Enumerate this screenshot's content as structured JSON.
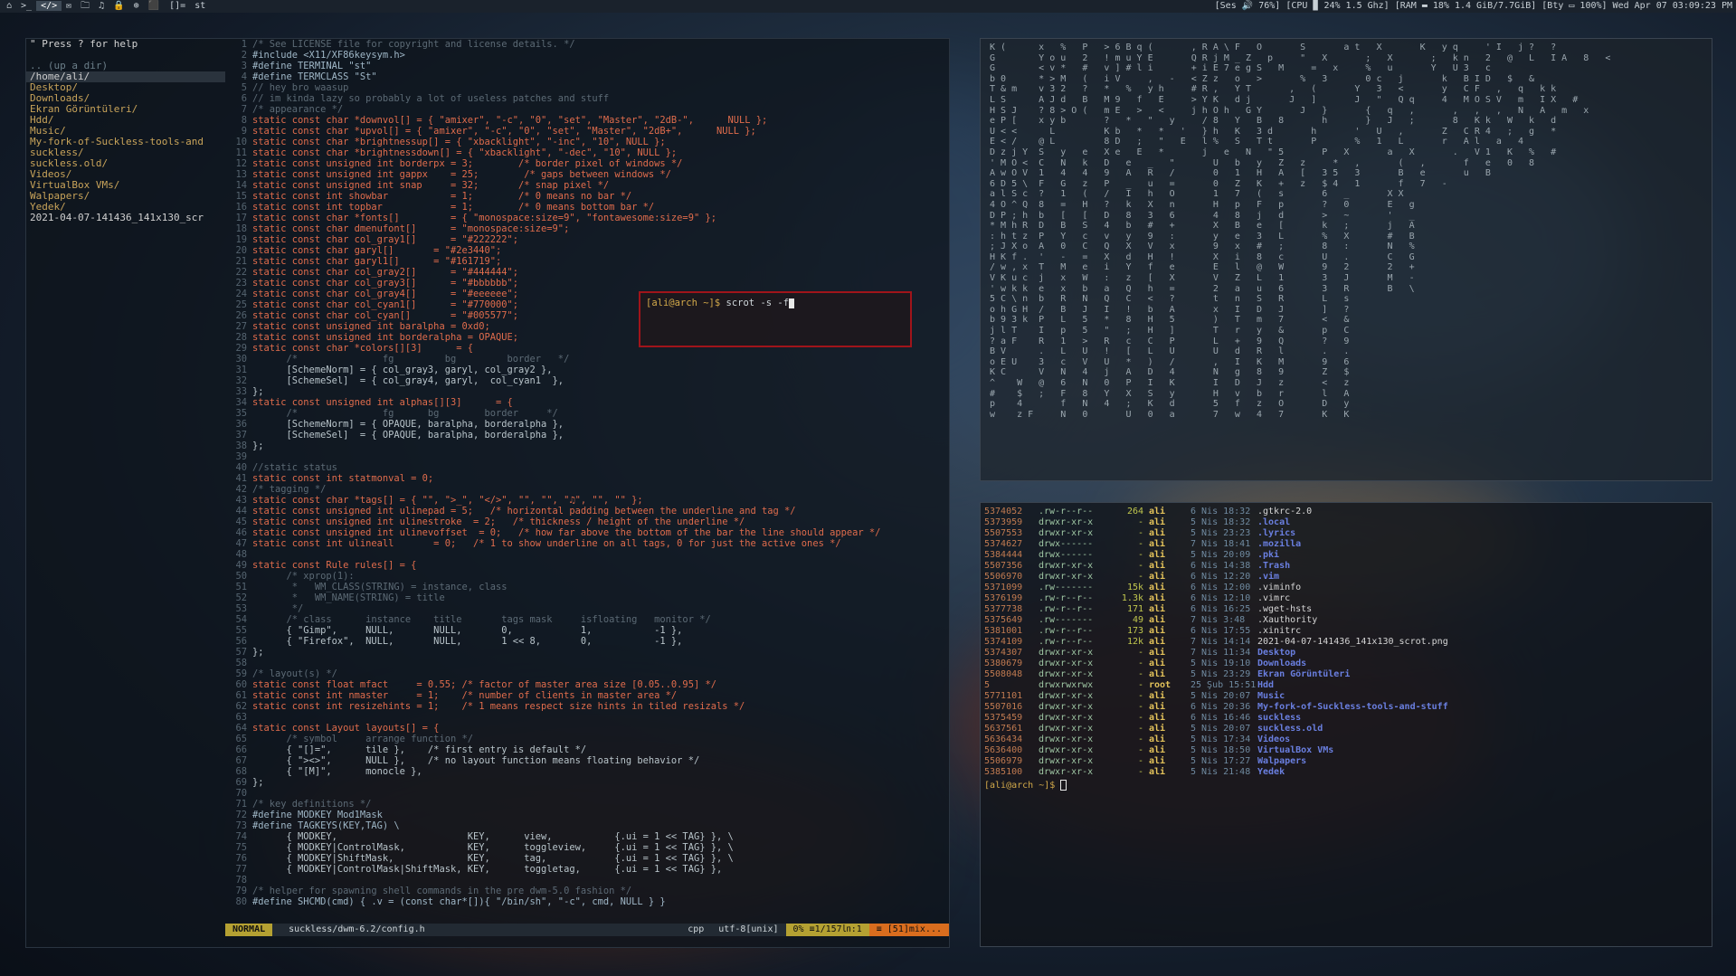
{
  "bar": {
    "tags": [
      "⌂",
      ">_",
      "</>",
      "✉",
      "🗀",
      "♫",
      "🔒",
      "⊕",
      "⬛"
    ],
    "active_tag_index": 2,
    "layout": "[]=",
    "window_title": "st",
    "status": "[Ses 🔊 76%] [CPU ▉ 24% 1.5 Ghz] [RAM ▬ 18% 1.4 GiB/7.7GiB] [Bty ▭ 100%] Wed Apr 07 03:09:23 PM"
  },
  "file_pane": {
    "help": "\" Press ? for help",
    "up": ".. (up a dir)",
    "cwd": "/home/ali/",
    "entries": [
      {
        "name": "Desktop/",
        "dir": true
      },
      {
        "name": "Downloads/",
        "dir": true
      },
      {
        "name": "Ekran Görüntüleri/",
        "dir": true
      },
      {
        "name": "Hdd/",
        "dir": true
      },
      {
        "name": "Music/",
        "dir": true
      },
      {
        "name": "My-fork-of-Suckless-tools-and",
        "dir": true
      },
      {
        "name": "suckless/",
        "dir": true
      },
      {
        "name": "suckless.old/",
        "dir": true
      },
      {
        "name": "Videos/",
        "dir": true
      },
      {
        "name": "VirtualBox VMs/",
        "dir": true
      },
      {
        "name": "Walpapers/",
        "dir": true
      },
      {
        "name": "Yedek/",
        "dir": true
      },
      {
        "name": "2021-04-07-141436_141x130_scr",
        "dir": false
      }
    ]
  },
  "code_lines": [
    {
      "t": "/* See LICENSE file for copyright and license details. */",
      "c": "cmt"
    },
    {
      "t": "#include <X11/XF86keysym.h>",
      "c": "pre"
    },
    {
      "t": "#define TERMINAL \"st\"",
      "c": "pre"
    },
    {
      "t": "#define TERMCLASS \"St\"",
      "c": "pre"
    },
    {
      "t": "// hey bro waasup",
      "c": "cmt"
    },
    {
      "t": "// im kinda lazy so probably a lot of useless patches and stuff",
      "c": "cmt"
    },
    {
      "t": "/* appearance */",
      "c": "cmt"
    },
    {
      "t": "static const char *downvol[] = { \"amixer\", \"-c\", \"0\", \"set\", \"Master\", \"2dB-\",      NULL };",
      "c": "k1"
    },
    {
      "t": "static const char *upvol[] = { \"amixer\", \"-c\", \"0\", \"set\", \"Master\", \"2dB+\",      NULL };",
      "c": "k1"
    },
    {
      "t": "static const char *brightnessup[] = { \"xbacklight\", \"-inc\", \"10\", NULL };",
      "c": "k1"
    },
    {
      "t": "static const char *brightnessdown[] = { \"xbacklight\", \"-dec\", \"10\", NULL };",
      "c": "k1"
    },
    {
      "t": "static const unsigned int borderpx = 3;        /* border pixel of windows */",
      "c": "k1"
    },
    {
      "t": "static const unsigned int gappx    = 25;        /* gaps between windows */",
      "c": "k1"
    },
    {
      "t": "static const unsigned int snap     = 32;       /* snap pixel */",
      "c": "k1"
    },
    {
      "t": "static const int showbar           = 1;        /* 0 means no bar */",
      "c": "k1"
    },
    {
      "t": "static const int topbar            = 1;        /* 0 means bottom bar */",
      "c": "k1"
    },
    {
      "t": "static const char *fonts[]         = { \"monospace:size=9\", \"fontawesome:size=9\" };",
      "c": "k1"
    },
    {
      "t": "static const char dmenufont[]      = \"monospace:size=9\";",
      "c": "k1"
    },
    {
      "t": "static const char col_gray1[]      = \"#222222\";",
      "c": "k1"
    },
    {
      "t": "static const char garyl[]       = \"#2e3440\";",
      "c": "k1"
    },
    {
      "t": "static const char garyl1[]      = \"#161719\";",
      "c": "k1"
    },
    {
      "t": "static const char col_gray2[]      = \"#444444\";",
      "c": "k1"
    },
    {
      "t": "static const char col_gray3[]      = \"#bbbbbb\";",
      "c": "k1"
    },
    {
      "t": "static const char col_gray4[]      = \"#eeeeee\";",
      "c": "k1"
    },
    {
      "t": "static const char col_cyan1[]      = \"#770000\";",
      "c": "k1"
    },
    {
      "t": "static const char col_cyan[]       = \"#005577\";",
      "c": "k1"
    },
    {
      "t": "static const unsigned int baralpha = 0xd0;",
      "c": "k1"
    },
    {
      "t": "static const unsigned int borderalpha = OPAQUE;",
      "c": "k1"
    },
    {
      "t": "static const char *colors[][3]      = {",
      "c": "k1"
    },
    {
      "t": "      /*               fg         bg         border   */",
      "c": "cmt"
    },
    {
      "t": "      [SchemeNorm] = { col_gray3, garyl, col_gray2 },",
      "c": ""
    },
    {
      "t": "      [SchemeSel]  = { col_gray4, garyl,  col_cyan1  },",
      "c": ""
    },
    {
      "t": "};",
      "c": ""
    },
    {
      "t": "static const unsigned int alphas[][3]      = {",
      "c": "k1"
    },
    {
      "t": "      /*               fg      bg        border     */",
      "c": "cmt"
    },
    {
      "t": "      [SchemeNorm] = { OPAQUE, baralpha, borderalpha },",
      "c": ""
    },
    {
      "t": "      [SchemeSel]  = { OPAQUE, baralpha, borderalpha },",
      "c": ""
    },
    {
      "t": "};",
      "c": ""
    },
    {
      "t": "",
      "c": ""
    },
    {
      "t": "//static status",
      "c": "cmt"
    },
    {
      "t": "static const int statmonval = 0;",
      "c": "k1"
    },
    {
      "t": "/* tagging */",
      "c": "cmt"
    },
    {
      "t": "static const char *tags[] = { \"\", \">_\", \"</>\", \"\", \"\", \"♫\", \"\", \"\" };",
      "c": "k1"
    },
    {
      "t": "static const unsigned int ulinepad = 5;   /* horizontal padding between the underline and tag */",
      "c": "k1"
    },
    {
      "t": "static const unsigned int ulinestroke  = 2;   /* thickness / height of the underline */",
      "c": "k1"
    },
    {
      "t": "static const unsigned int ulinevoffset  = 0;   /* how far above the bottom of the bar the line should appear */",
      "c": "k1"
    },
    {
      "t": "static const int ulineall       = 0;   /* 1 to show underline on all tags, 0 for just the active ones */",
      "c": "k1"
    },
    {
      "t": "",
      "c": ""
    },
    {
      "t": "static const Rule rules[] = {",
      "c": "k1"
    },
    {
      "t": "      /* xprop(1):",
      "c": "cmt"
    },
    {
      "t": "       *   WM_CLASS(STRING) = instance, class",
      "c": "cmt"
    },
    {
      "t": "       *   WM_NAME(STRING) = title",
      "c": "cmt"
    },
    {
      "t": "       */",
      "c": "cmt"
    },
    {
      "t": "      /* class      instance    title       tags mask     isfloating   monitor */",
      "c": "cmt"
    },
    {
      "t": "      { \"Gimp\",     NULL,       NULL,       0,            1,           -1 },",
      "c": ""
    },
    {
      "t": "      { \"Firefox\",  NULL,       NULL,       1 << 8,       0,           -1 },",
      "c": ""
    },
    {
      "t": "};",
      "c": ""
    },
    {
      "t": "",
      "c": ""
    },
    {
      "t": "/* layout(s) */",
      "c": "cmt"
    },
    {
      "t": "static const float mfact     = 0.55; /* factor of master area size [0.05..0.95] */",
      "c": "k1"
    },
    {
      "t": "static const int nmaster     = 1;    /* number of clients in master area */",
      "c": "k1"
    },
    {
      "t": "static const int resizehints = 1;    /* 1 means respect size hints in tiled resizals */",
      "c": "k1"
    },
    {
      "t": "",
      "c": ""
    },
    {
      "t": "static const Layout layouts[] = {",
      "c": "k1"
    },
    {
      "t": "      /* symbol     arrange function */",
      "c": "cmt"
    },
    {
      "t": "      { \"[]=\",      tile },    /* first entry is default */",
      "c": ""
    },
    {
      "t": "      { \"><>\",      NULL },    /* no layout function means floating behavior */",
      "c": ""
    },
    {
      "t": "      { \"[M]\",      monocle },",
      "c": ""
    },
    {
      "t": "};",
      "c": ""
    },
    {
      "t": "",
      "c": ""
    },
    {
      "t": "/* key definitions */",
      "c": "cmt"
    },
    {
      "t": "#define MODKEY Mod1Mask",
      "c": "pre"
    },
    {
      "t": "#define TAGKEYS(KEY,TAG) \\",
      "c": "pre"
    },
    {
      "t": "      { MODKEY,                       KEY,      view,           {.ui = 1 << TAG} }, \\",
      "c": ""
    },
    {
      "t": "      { MODKEY|ControlMask,           KEY,      toggleview,     {.ui = 1 << TAG} }, \\",
      "c": ""
    },
    {
      "t": "      { MODKEY|ShiftMask,             KEY,      tag,            {.ui = 1 << TAG} }, \\",
      "c": ""
    },
    {
      "t": "      { MODKEY|ControlMask|ShiftMask, KEY,      toggletag,      {.ui = 1 << TAG} },",
      "c": ""
    },
    {
      "t": "",
      "c": ""
    },
    {
      "t": "/* helper for spawning shell commands in the pre dwm-5.0 fashion */",
      "c": "cmt"
    },
    {
      "t": "#define SHCMD(cmd) { .v = (const char*[]){ \"/bin/sh\", \"-c\", cmd, NULL } }",
      "c": "pre"
    }
  ],
  "statusline": {
    "mode": "NORMAL",
    "file": "suckless/dwm-6.2/config.h",
    "filetype": "cpp",
    "encoding": "utf-8[unix]",
    "position": "0% ≡1/157㏑:1",
    "warning": "≡ [51]mix..."
  },
  "scrot": {
    "prompt": "[ali@arch ~]$ ",
    "command": "scrot -s -f"
  },
  "matrix_lines": [
    "K (      x   %   P   > 6 B q (       , R A \\ F   O       S       a t   X       K   y q     ' I   j ?   ?",
    "G        Y o u   2   ! m u Y E       Q R j M _ Z   p     \"   X       ;   X       ;   k n   2   @   L   I A   8   <",
    "G        < v *   #   v ] # l i       + i E 7 e g S   M     =   x     %   u       Y   U 3   c",
    "b 0      * > M   (   i V     ,   -   < Z z   o   >       %   3       0 c   j       k   B I D   $   &",
    "T & m    v 3 2   ?   *   %   y h     # R ,   Y T       ,   (       Y   3   <       y   C F   ,   q   k k",
    "L S      A J d   B   M 9   f   E     > Y K   d j       J   ]       J   \"   Q q     4   M O S V   m   I X   #",
    "H S J    ? 8 > O (   m E   >   <     j h O h   G Y       J   }       {   q   ,       ,   ,   ,   N   A   m   x",
    "e P [    x y b       ?   *   \"   y     / 8   Y   B   8       h       }   J   ;       8   K k   W   k   d",
    "U < <      L         K b   *   *   '   } h   K   3 d       h       '   U   ,       Z   C R 4   ;   g   *",
    "E < /    @ L         8 D   ;   \"   E   l %   S   T t       P       %   1   L       r   A l   a   4",
    "D z j Y  S   y   e   X e   E   *       j   e   N   \" 5       P   X       a   X       .   V 1   K   %   #",
    "' M O <  C   N   k   D   e   _   \"       U   b   y   Z   z     *   ,       (   ,       f   e   0   8",
    "A w O V  1   4   4   9   A   R   /       0   1   H   A   [   3 5   3       B   e       u   B",
    "6 D 5 \\  F   G   z   P   _   u   =       0   Z   K   +   z   $ 4   1       f   7   -",
    "a l S c  ?   1   (   /   I   h   O       1   7   (   s       6   _       X X",
    "4 O ^ Q  8   =   H   ?   k   X   n       H   p   F   p       ?   0       E   g",
    "D P ; h  b   [   [   D   8   3   6       4   8   j   d       >   ~       '   _",
    "* M h R  D   B   S   4   b   #   +       X   B   e   [       k   ;       j   A",
    ": h t z  P   Y   c   v   y   9   :       y   e   3   L       %   X       #   B",
    "; J X o  A   0   C   Q   X   V   x       9   x   #   ;       8   :       N   %",
    "H K f .  '   -   =   X   d   H   !       X   i   8   c       U   .       C   G",
    "/ w , x  T   M   e   i   Y   f   e       E   l   @   W       9   2       2   +",
    "V K u c  j   x   W   :   z   [   X       V   Z   L   1       3   J       M   -",
    "' w k k  e   x   b   a   Q   h   =       2   a   u   6       3   R       B   \\",
    "5 C \\ n  b   R   N   Q   C   <   ?       t   n   S   R       L   s",
    "o h G H  /   B   J   I   !   b   A       x   I   D   J       ]   ?",
    "b 9 3 k  P   L   5   *   8   H   5       )   T   m   7       <   &",
    "j l T    I   p   5   \"   ;   H   ]       T   r   y   &       p   C",
    "? a F    R   1   >   R   c   C   P       L   +   9   Q       ?   9",
    "B V      .   L   U   !   [   L   U       U   d   R   l       .   .",
    "o E U    3   c   V   U   *   )   /       ,   I   K   M       9   6",
    "K C      V   N   4   j   A   D   4       N   g   8   9       Z   $",
    "^    W   @   6   N   0   P   I   K       I   D   J   z       <   z",
    "#    $   ;   F   8   Y   X   S   y       H   v   b   r       l   A",
    "p    4       f   N   4   ;   K   d       5   f   z   O       D   y",
    "w    z F     N   0       U   0   a       7   w   4   7       K   K"
  ],
  "ls_rows": [
    {
      "inode": "5374052",
      "perm": ".rw-r--r--",
      "size": "264",
      "user": "ali",
      "date": "6 Nis 18:32",
      "name": ".gtkrc-2.0",
      "dir": false
    },
    {
      "inode": "5373959",
      "perm": "drwxr-xr-x",
      "size": "-",
      "user": "ali",
      "date": "5 Nis 18:32",
      "name": ".local",
      "dir": true
    },
    {
      "inode": "5507553",
      "perm": "drwxr-xr-x",
      "size": "-",
      "user": "ali",
      "date": "5 Nis 23:23",
      "name": ".lyrics",
      "dir": true
    },
    {
      "inode": "5374627",
      "perm": "drwx------",
      "size": "-",
      "user": "ali",
      "date": "7 Nis 18:41",
      "name": ".mozilla",
      "dir": true
    },
    {
      "inode": "5384444",
      "perm": "drwx------",
      "size": "-",
      "user": "ali",
      "date": "5 Nis 20:09",
      "name": ".pki",
      "dir": true
    },
    {
      "inode": "5507356",
      "perm": "drwxr-xr-x",
      "size": "-",
      "user": "ali",
      "date": "6 Nis 14:38",
      "name": ".Trash",
      "dir": true
    },
    {
      "inode": "5506970",
      "perm": "drwxr-xr-x",
      "size": "-",
      "user": "ali",
      "date": "6 Nis 12:20",
      "name": ".vim",
      "dir": true
    },
    {
      "inode": "5371099",
      "perm": ".rw-------",
      "size": "15k",
      "user": "ali",
      "date": "6 Nis 12:00",
      "name": ".viminfo",
      "dir": false
    },
    {
      "inode": "5376199",
      "perm": ".rw-r--r--",
      "size": "1.3k",
      "user": "ali",
      "date": "6 Nis 12:10",
      "name": ".vimrc",
      "dir": false
    },
    {
      "inode": "5377738",
      "perm": ".rw-r--r--",
      "size": "171",
      "user": "ali",
      "date": "6 Nis 16:25",
      "name": ".wget-hsts",
      "dir": false
    },
    {
      "inode": "5375649",
      "perm": ".rw-------",
      "size": "49",
      "user": "ali",
      "date": "7 Nis 3:48",
      "name": ".Xauthority",
      "dir": false
    },
    {
      "inode": "5381001",
      "perm": ".rw-r--r--",
      "size": "173",
      "user": "ali",
      "date": "6 Nis 17:55",
      "name": ".xinitrc",
      "dir": false
    },
    {
      "inode": "5374109",
      "perm": ".rw-r--r--",
      "size": "12k",
      "user": "ali",
      "date": "7 Nis 14:14",
      "name": "2021-04-07-141436_141x130_scrot.png",
      "dir": false
    },
    {
      "inode": "5374307",
      "perm": "drwxr-xr-x",
      "size": "-",
      "user": "ali",
      "date": "7 Nis 11:34",
      "name": "Desktop",
      "dir": true
    },
    {
      "inode": "5380679",
      "perm": "drwxr-xr-x",
      "size": "-",
      "user": "ali",
      "date": "5 Nis 19:10",
      "name": "Downloads",
      "dir": true
    },
    {
      "inode": "5508048",
      "perm": "drwxr-xr-x",
      "size": "-",
      "user": "ali",
      "date": "5 Nis 23:29",
      "name": "Ekran Görüntüleri",
      "dir": true
    },
    {
      "inode": "5",
      "perm": "drwxrwxrwx",
      "size": "-",
      "user": "root",
      "date": "25 Şub 15:51",
      "name": "Hdd",
      "dir": true
    },
    {
      "inode": "5771101",
      "perm": "drwxr-xr-x",
      "size": "-",
      "user": "ali",
      "date": "5 Nis 20:07",
      "name": "Music",
      "dir": true
    },
    {
      "inode": "5507016",
      "perm": "drwxr-xr-x",
      "size": "-",
      "user": "ali",
      "date": "6 Nis 20:36",
      "name": "My-fork-of-Suckless-tools-and-stuff",
      "dir": true
    },
    {
      "inode": "5375459",
      "perm": "drwxr-xr-x",
      "size": "-",
      "user": "ali",
      "date": "6 Nis 16:46",
      "name": "suckless",
      "dir": true
    },
    {
      "inode": "5637561",
      "perm": "drwxr-xr-x",
      "size": "-",
      "user": "ali",
      "date": "5 Nis 20:07",
      "name": "suckless.old",
      "dir": true
    },
    {
      "inode": "5636434",
      "perm": "drwxr-xr-x",
      "size": "-",
      "user": "ali",
      "date": "5 Nis 17:34",
      "name": "Videos",
      "dir": true
    },
    {
      "inode": "5636400",
      "perm": "drwxr-xr-x",
      "size": "-",
      "user": "ali",
      "date": "5 Nis 18:50",
      "name": "VirtualBox VMs",
      "dir": true
    },
    {
      "inode": "5506979",
      "perm": "drwxr-xr-x",
      "size": "-",
      "user": "ali",
      "date": "5 Nis 17:27",
      "name": "Walpapers",
      "dir": true
    },
    {
      "inode": "5385100",
      "perm": "drwxr-xr-x",
      "size": "-",
      "user": "ali",
      "date": "5 Nis 21:48",
      "name": "Yedek",
      "dir": true
    }
  ],
  "ls_prompt": "[ali@arch ~]$ "
}
